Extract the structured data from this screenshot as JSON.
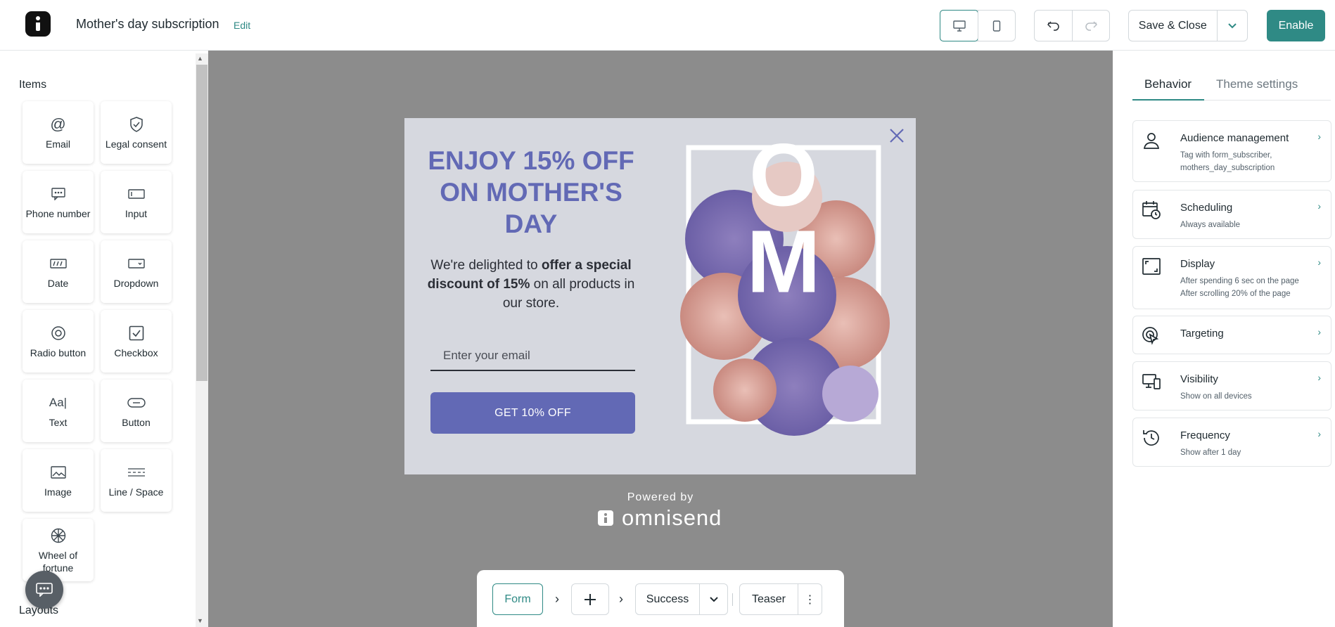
{
  "header": {
    "title": "Mother's day subscription",
    "edit_label": "Edit",
    "save_label": "Save & Close",
    "enable_label": "Enable",
    "accent_color": "#2f8a85"
  },
  "sidebar": {
    "items_title": "Items",
    "layouts_title": "Layouts",
    "items": [
      {
        "label": "Email",
        "icon": "at-icon"
      },
      {
        "label": "Legal consent",
        "icon": "shield-check-icon"
      },
      {
        "label": "Phone number",
        "icon": "message-icon"
      },
      {
        "label": "Input",
        "icon": "input-icon"
      },
      {
        "label": "Date",
        "icon": "date-icon"
      },
      {
        "label": "Dropdown",
        "icon": "dropdown-icon"
      },
      {
        "label": "Radio button",
        "icon": "radio-icon"
      },
      {
        "label": "Checkbox",
        "icon": "checkbox-icon"
      },
      {
        "label": "Text",
        "icon": "text-icon"
      },
      {
        "label": "Button",
        "icon": "button-icon"
      },
      {
        "label": "Image",
        "icon": "image-icon"
      },
      {
        "label": "Line / Space",
        "icon": "line-space-icon"
      },
      {
        "label": "Wheel of fortune",
        "icon": "wheel-icon"
      }
    ]
  },
  "popup": {
    "headline": "ENJOY 15% OFF ON MOTHER'S DAY",
    "body_pre": "We're delighted to ",
    "body_bold": "offer a special discount of 15%",
    "body_post": " on all products in our store.",
    "email_placeholder": "Enter your email",
    "cta_label": "GET 10% OFF",
    "art_text": "MOM",
    "brand_color": "#6269b5"
  },
  "footer": {
    "powered_by": "Powered by",
    "brand": "omnisend"
  },
  "steps": {
    "form": "Form",
    "success": "Success",
    "teaser": "Teaser"
  },
  "right_panel": {
    "tabs": [
      "Behavior",
      "Theme settings"
    ],
    "cards": [
      {
        "title": "Audience management",
        "subtitle": "Tag with form_subscriber, mothers_day_subscription",
        "icon": "user-icon"
      },
      {
        "title": "Scheduling",
        "subtitle": "Always available",
        "icon": "calendar-clock-icon"
      },
      {
        "title": "Display",
        "subtitle": "After spending 6 sec on the page",
        "subtitle2": "After scrolling 20% of the page",
        "icon": "display-frame-icon"
      },
      {
        "title": "Targeting",
        "subtitle": "",
        "icon": "pointer-target-icon"
      },
      {
        "title": "Visibility",
        "subtitle": "Show on all devices",
        "icon": "devices-icon"
      },
      {
        "title": "Frequency",
        "subtitle": "Show after 1 day",
        "icon": "history-icon"
      }
    ]
  }
}
